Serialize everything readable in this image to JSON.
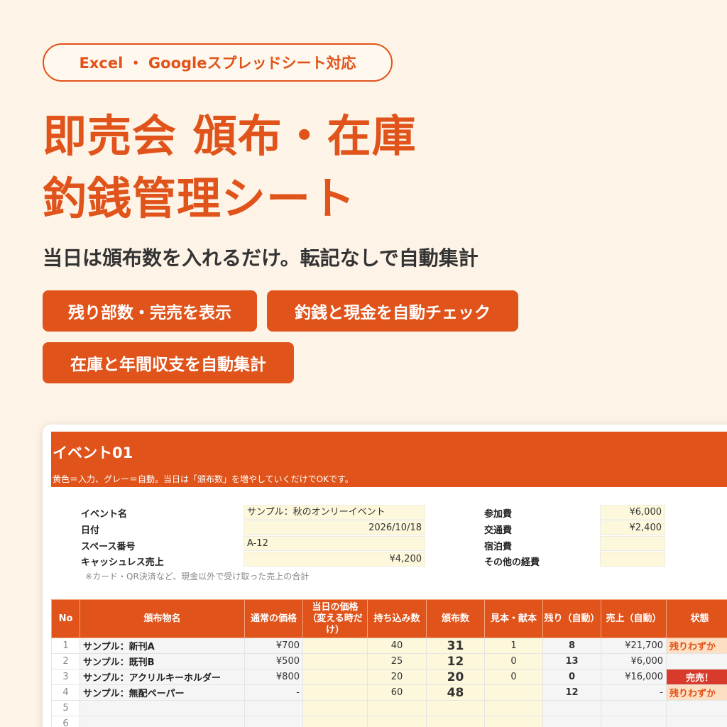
{
  "badge": "Excel ・ Googleスプレッドシート対応",
  "title_line1": "即売会 頒布・在庫",
  "title_line2": "釣銭管理シート",
  "subtitle": "当日は頒布数を入れるだけ。転記なしで自動集計",
  "tags": [
    "残り部数・完売を表示",
    "釣銭と現金を自動チェック",
    "在庫と年間収支を自動集計"
  ],
  "sheet": {
    "title": "イベント01",
    "note": "黄色＝入力、グレー＝自動。当日は「頒布数」を増やしていくだけでOKです。",
    "info_left": [
      {
        "label": "イベント名",
        "value": "サンプル：秋のオンリーイベント"
      },
      {
        "label": "日付",
        "value": "2026/10/18"
      },
      {
        "label": "スペース番号",
        "value": "A-12"
      },
      {
        "label": "キャッシュレス売上",
        "value": "¥4,200"
      }
    ],
    "cashless_note": "※カード・QR決済など、現金以外で受け取った売上の合計",
    "info_right": [
      {
        "label": "参加費",
        "value": "¥6,000"
      },
      {
        "label": "交通費",
        "value": "¥2,400"
      },
      {
        "label": "宿泊費",
        "value": ""
      },
      {
        "label": "その他の経費",
        "value": ""
      }
    ],
    "columns": [
      "No",
      "頒布物名",
      "通常の価格",
      "当日の価格（変える時だけ）",
      "持ち込み数",
      "頒布数",
      "見本・献本",
      "残り（自動）",
      "売上（自動）",
      "状態"
    ],
    "rows": [
      {
        "no": "1",
        "name": "サンプル：新刊A",
        "price": "¥700",
        "day_price": "",
        "brought": "40",
        "sold": "31",
        "sample": "1",
        "remain": "8",
        "sales": "¥21,700",
        "status": "残りわずか"
      },
      {
        "no": "2",
        "name": "サンプル：既刊B",
        "price": "¥500",
        "day_price": "",
        "brought": "25",
        "sold": "12",
        "sample": "0",
        "remain": "13",
        "sales": "¥6,000",
        "status": ""
      },
      {
        "no": "3",
        "name": "サンプル：アクリルキーホルダー",
        "price": "¥800",
        "day_price": "",
        "brought": "20",
        "sold": "20",
        "sample": "0",
        "remain": "0",
        "sales": "¥16,000",
        "status": "完売！"
      },
      {
        "no": "4",
        "name": "サンプル：無配ペーパー",
        "price": "-",
        "day_price": "",
        "brought": "60",
        "sold": "48",
        "sample": "",
        "remain": "12",
        "sales": "-",
        "status": "残りわずか"
      },
      {
        "no": "5",
        "name": "",
        "price": "",
        "day_price": "",
        "brought": "",
        "sold": "",
        "sample": "",
        "remain": "",
        "sales": "",
        "status": ""
      },
      {
        "no": "6",
        "name": "",
        "price": "",
        "day_price": "",
        "brought": "",
        "sold": "",
        "sample": "",
        "remain": "",
        "sales": "",
        "status": ""
      }
    ]
  }
}
